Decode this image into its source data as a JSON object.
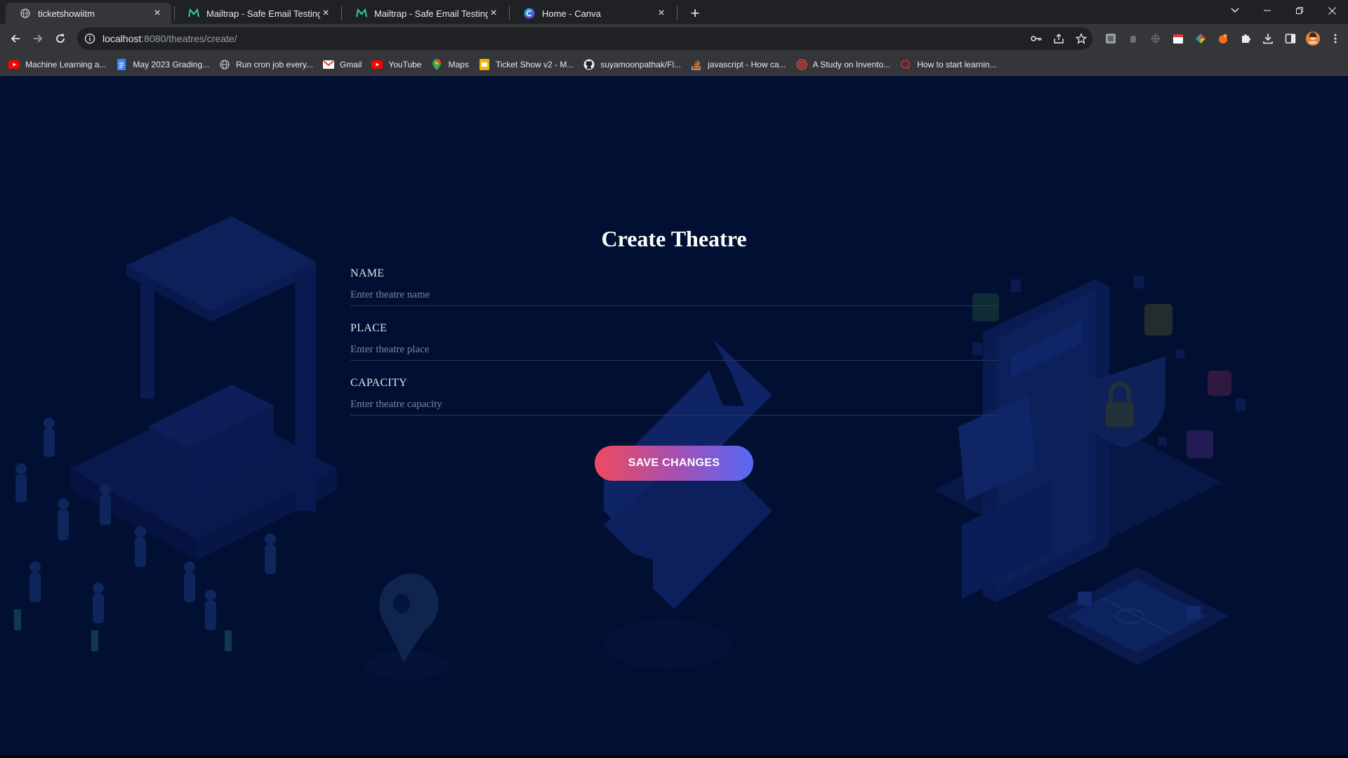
{
  "browser": {
    "tabs": [
      {
        "title": "ticketshowiitm",
        "icon": "globe-icon",
        "active": true
      },
      {
        "title": "Mailtrap - Safe Email Testing",
        "icon": "mailtrap-icon",
        "active": false
      },
      {
        "title": "Mailtrap - Safe Email Testing",
        "icon": "mailtrap-icon",
        "active": false
      },
      {
        "title": "Home - Canva",
        "icon": "canva-icon",
        "active": false
      }
    ],
    "close_glyph": "×",
    "new_tab_glyph": "+",
    "url": {
      "host": "localhost",
      "rest": ":8080/theatres/create/"
    },
    "bookmarks": [
      {
        "label": "Machine Learning a...",
        "icon": "youtube-icon"
      },
      {
        "label": "May 2023 Grading...",
        "icon": "docs-icon"
      },
      {
        "label": "Run cron job every...",
        "icon": "globe-icon"
      },
      {
        "label": "Gmail",
        "icon": "gmail-icon"
      },
      {
        "label": "YouTube",
        "icon": "youtube-icon"
      },
      {
        "label": "Maps",
        "icon": "maps-icon"
      },
      {
        "label": "Ticket Show v2 - M...",
        "icon": "slides-icon"
      },
      {
        "label": "suyamoonpathak/Fl...",
        "icon": "github-icon"
      },
      {
        "label": "javascript - How ca...",
        "icon": "stackoverflow-icon"
      },
      {
        "label": "A Study on Invento...",
        "icon": "target-icon"
      },
      {
        "label": "How to start learnin...",
        "icon": "quora-icon"
      }
    ]
  },
  "form": {
    "title": "Create Theatre",
    "fields": [
      {
        "label": "NAME",
        "placeholder": "Enter theatre name",
        "value": ""
      },
      {
        "label": "PLACE",
        "placeholder": "Enter theatre place",
        "value": ""
      },
      {
        "label": "CAPACITY",
        "placeholder": "Enter theatre capacity",
        "value": ""
      }
    ],
    "submit_label": "SAVE CHANGES"
  },
  "colors": {
    "page_background": "#011032",
    "button_gradient": [
      "#ef4b5e",
      "#5469f5"
    ]
  }
}
